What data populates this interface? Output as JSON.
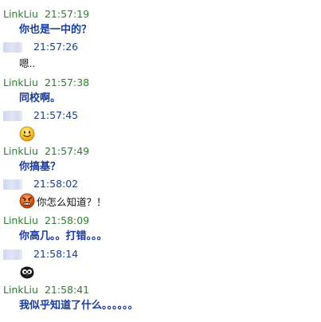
{
  "messages": [
    {
      "sender": "LinkLiu",
      "time": "21:57:19",
      "text": "你也是一中的？"
    },
    {
      "sender": "",
      "time": "21:57:26",
      "text": "嗯.."
    },
    {
      "sender": "LinkLiu",
      "time": "21:57:38",
      "text": "同校啊。"
    },
    {
      "sender": "",
      "time": "21:57:45",
      "emoji": "smile-icon"
    },
    {
      "sender": "LinkLiu",
      "time": "21:57:49",
      "text": "你搞基？"
    },
    {
      "sender": "",
      "time": "21:58:02",
      "emoji": "angry-face-icon",
      "text": "你怎么知道？！"
    },
    {
      "sender": "LinkLiu",
      "time": "21:58:09",
      "text": "你高几。。打错。。。"
    },
    {
      "sender": "",
      "time": "21:58:14",
      "emoji": "owl-face-icon"
    },
    {
      "sender": "LinkLiu",
      "time": "21:58:41",
      "text": "我似乎知道了什么。。。。。。"
    }
  ]
}
